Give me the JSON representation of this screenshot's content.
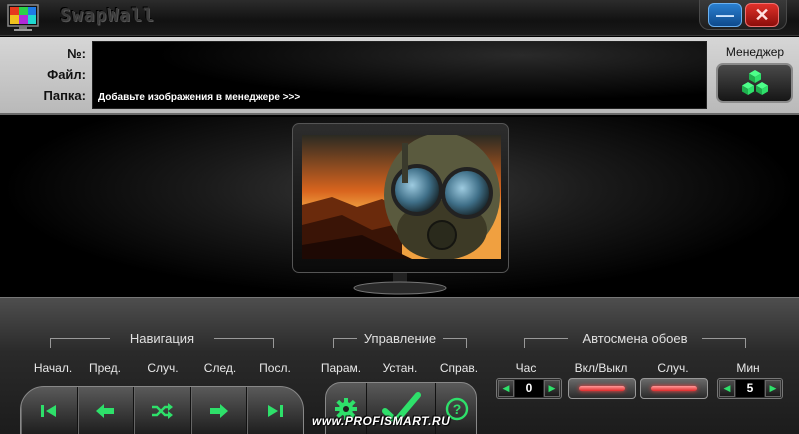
{
  "window": {
    "title": "SwapWall",
    "minimize_glyph": "—",
    "close_glyph": "✕"
  },
  "info": {
    "number_label": "№:",
    "file_label": "Файл:",
    "folder_label": "Папка:",
    "number_value": "",
    "file_value": "",
    "folder_value": "Добавьте изображения в менеджере >>>"
  },
  "manager": {
    "label": "Менеджер",
    "icon": "cubes-icon"
  },
  "navigation": {
    "title": "Навигация",
    "buttons": [
      {
        "label": "Начал.",
        "icon": "skip-first-icon"
      },
      {
        "label": "Пред.",
        "icon": "arrow-left-icon"
      },
      {
        "label": "Случ.",
        "icon": "shuffle-icon"
      },
      {
        "label": "След.",
        "icon": "arrow-right-icon"
      },
      {
        "label": "Посл.",
        "icon": "skip-last-icon"
      }
    ]
  },
  "control": {
    "title": "Управление",
    "buttons": [
      {
        "label": "Парам.",
        "icon": "gear-icon"
      },
      {
        "label": "Устан.",
        "icon": "check-icon"
      },
      {
        "label": "Справ.",
        "icon": "help-icon"
      }
    ]
  },
  "autochange": {
    "title": "Автосмена обоев",
    "hour_label": "Час",
    "hour_value": "0",
    "toggle_label": "Вкл/Выкл",
    "random_label": "Случ.",
    "min_label": "Мин",
    "min_value": "5"
  },
  "watermark": "www.PROFISMART.RU",
  "colors": {
    "accent_green": "#2ee06a",
    "led_red": "#e02a2a",
    "minimize_blue": "#1f6fc0",
    "close_red": "#c81e18"
  }
}
